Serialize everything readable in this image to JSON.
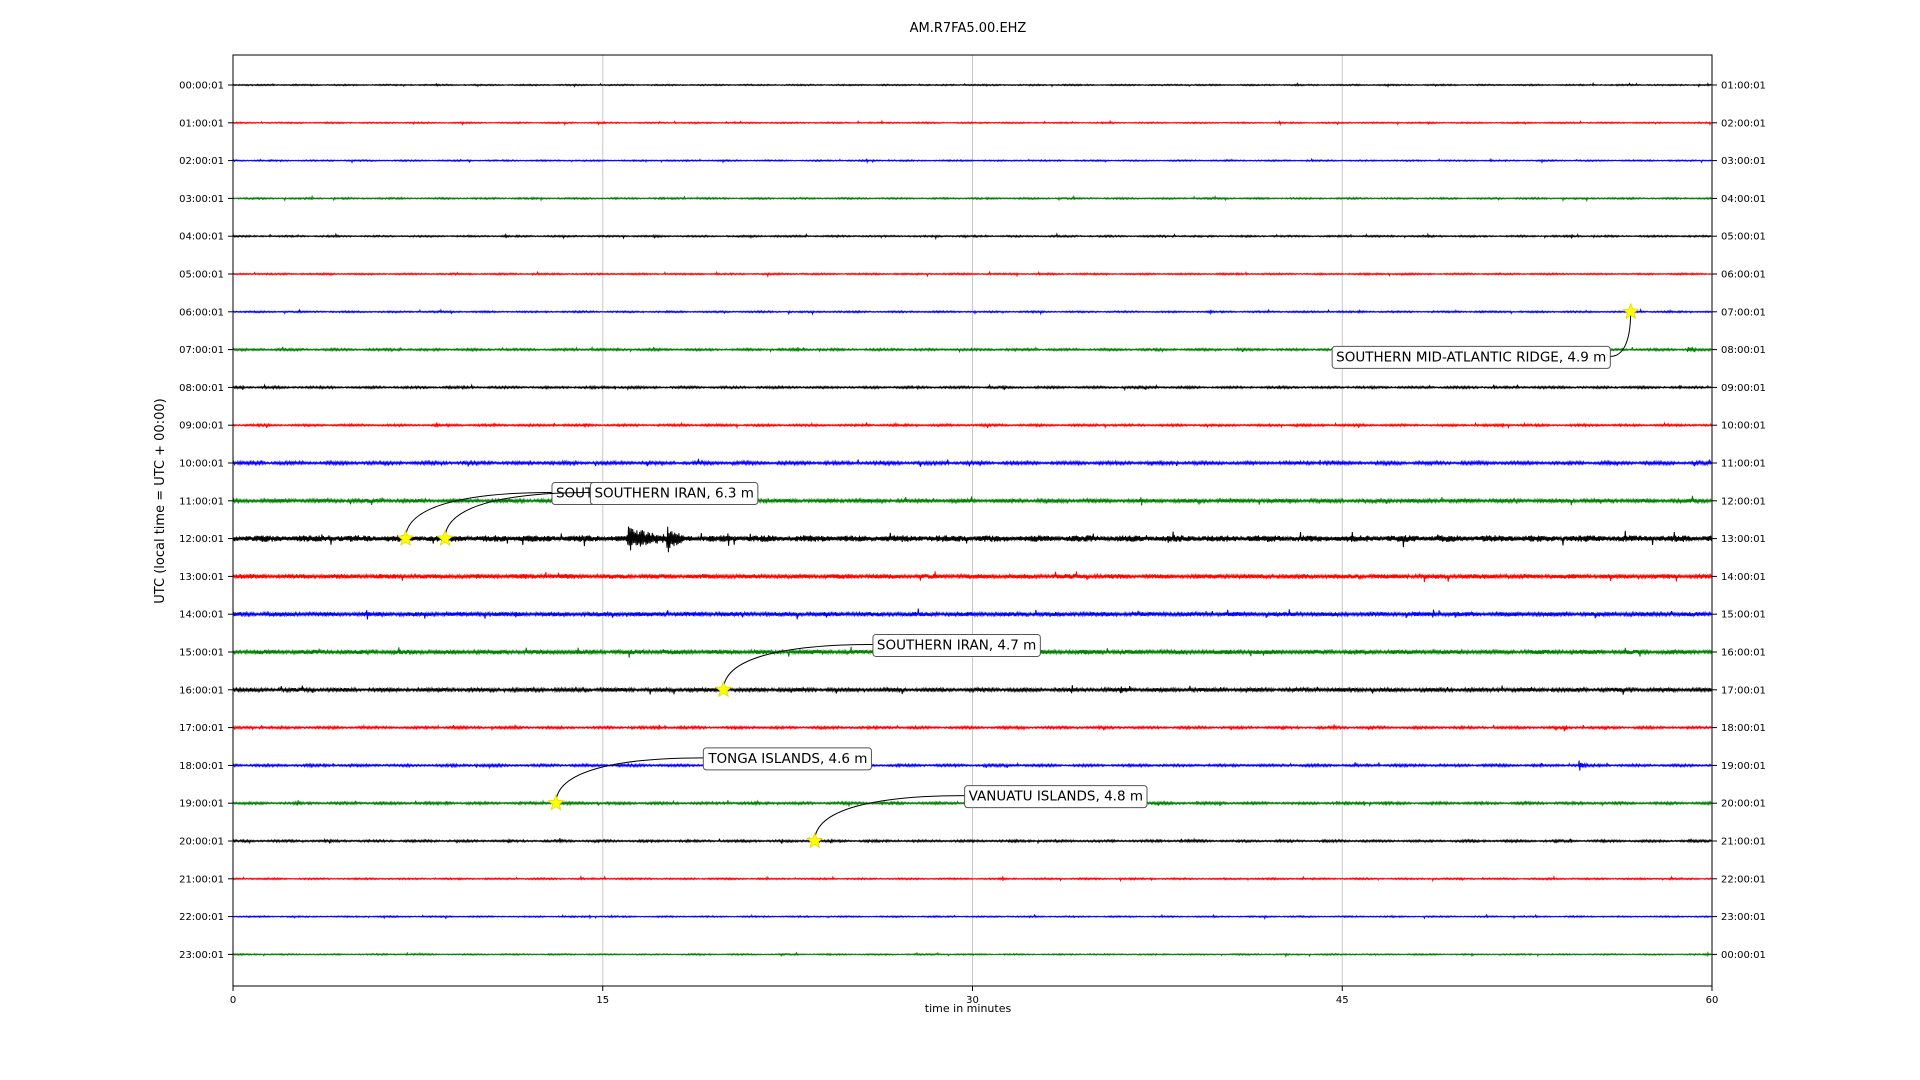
{
  "chart_data": {
    "type": "line",
    "title": "AM.R7FA5.00.EHZ",
    "xlabel": "time in minutes",
    "ylabel": "UTC (local time = UTC + 00:00)",
    "xlim": [
      0,
      60
    ],
    "xticks": [
      0,
      15,
      30,
      45,
      60
    ],
    "xtick_labels": [
      "0",
      "15",
      "30",
      "45",
      "60"
    ],
    "grid": "vertical",
    "series_colors": [
      "#000000",
      "#ff0000",
      "#0000ff",
      "#008000"
    ],
    "left_labels": [
      "00:00:01",
      "01:00:01",
      "02:00:01",
      "03:00:01",
      "04:00:01",
      "05:00:01",
      "06:00:01",
      "07:00:01",
      "08:00:01",
      "09:00:01",
      "10:00:01",
      "11:00:01",
      "12:00:01",
      "13:00:01",
      "14:00:01",
      "15:00:01",
      "16:00:01",
      "17:00:01",
      "18:00:01",
      "19:00:01",
      "20:00:01",
      "21:00:01",
      "22:00:01",
      "23:00:01"
    ],
    "right_labels": [
      "01:00:01",
      "02:00:01",
      "03:00:01",
      "04:00:01",
      "05:00:01",
      "06:00:01",
      "07:00:01",
      "08:00:01",
      "09:00:01",
      "10:00:01",
      "11:00:01",
      "12:00:01",
      "13:00:01",
      "14:00:01",
      "15:00:01",
      "16:00:01",
      "17:00:01",
      "18:00:01",
      "19:00:01",
      "20:00:01",
      "21:00:01",
      "22:00:01",
      "23:00:01",
      "00:00:01"
    ],
    "noise_level": [
      0.5,
      0.5,
      0.5,
      0.6,
      0.6,
      0.6,
      0.6,
      0.8,
      0.8,
      0.8,
      1.2,
      1.4,
      2.4,
      1.7,
      1.6,
      1.6,
      1.4,
      0.9,
      0.9,
      0.9,
      0.8,
      0.6,
      0.5,
      0.5
    ],
    "signals": [
      {
        "row": 12,
        "start": 16.0,
        "end": 20.0,
        "peak": 14
      },
      {
        "row": 12,
        "start": 17.6,
        "end": 19.0,
        "peak": 16
      },
      {
        "row": 17,
        "start": 54.0,
        "end": 54.3,
        "peak": 5
      },
      {
        "row": 18,
        "start": 54.6,
        "end": 55.2,
        "peak": 7
      },
      {
        "row": 7,
        "start": 59.0,
        "end": 60.0,
        "peak": 3
      },
      {
        "row": 16,
        "start": 36.0,
        "end": 37.5,
        "peak": 4
      }
    ],
    "events": [
      {
        "label": "SOUTHERN MID-ATLANTIC RIDGE, 4.9 m",
        "row": 6,
        "minute": 56.7,
        "box_x": 0.7425,
        "box_row": 7.18
      },
      {
        "label": "SOUTHERN IRAN, 6.3 m",
        "row": 12,
        "minute": 7.0,
        "box_x": 0.215,
        "box_row": 10.78
      },
      {
        "label": "SOUTHERN IRAN, 6.3 m",
        "row": 12,
        "minute": 8.6,
        "box_x": 0.241,
        "box_row": 10.78
      },
      {
        "label": "SOUTHERN IRAN, 4.7 m",
        "row": 16,
        "minute": 19.9,
        "box_x": 0.432,
        "box_row": 14.8
      },
      {
        "label": "TONGA ISLANDS, 4.6 m",
        "row": 19,
        "minute": 13.1,
        "box_x": 0.318,
        "box_row": 17.8
      },
      {
        "label": "VANUATU ISLANDS, 4.8 m",
        "row": 20,
        "minute": 23.6,
        "box_x": 0.494,
        "box_row": 18.8
      }
    ]
  }
}
